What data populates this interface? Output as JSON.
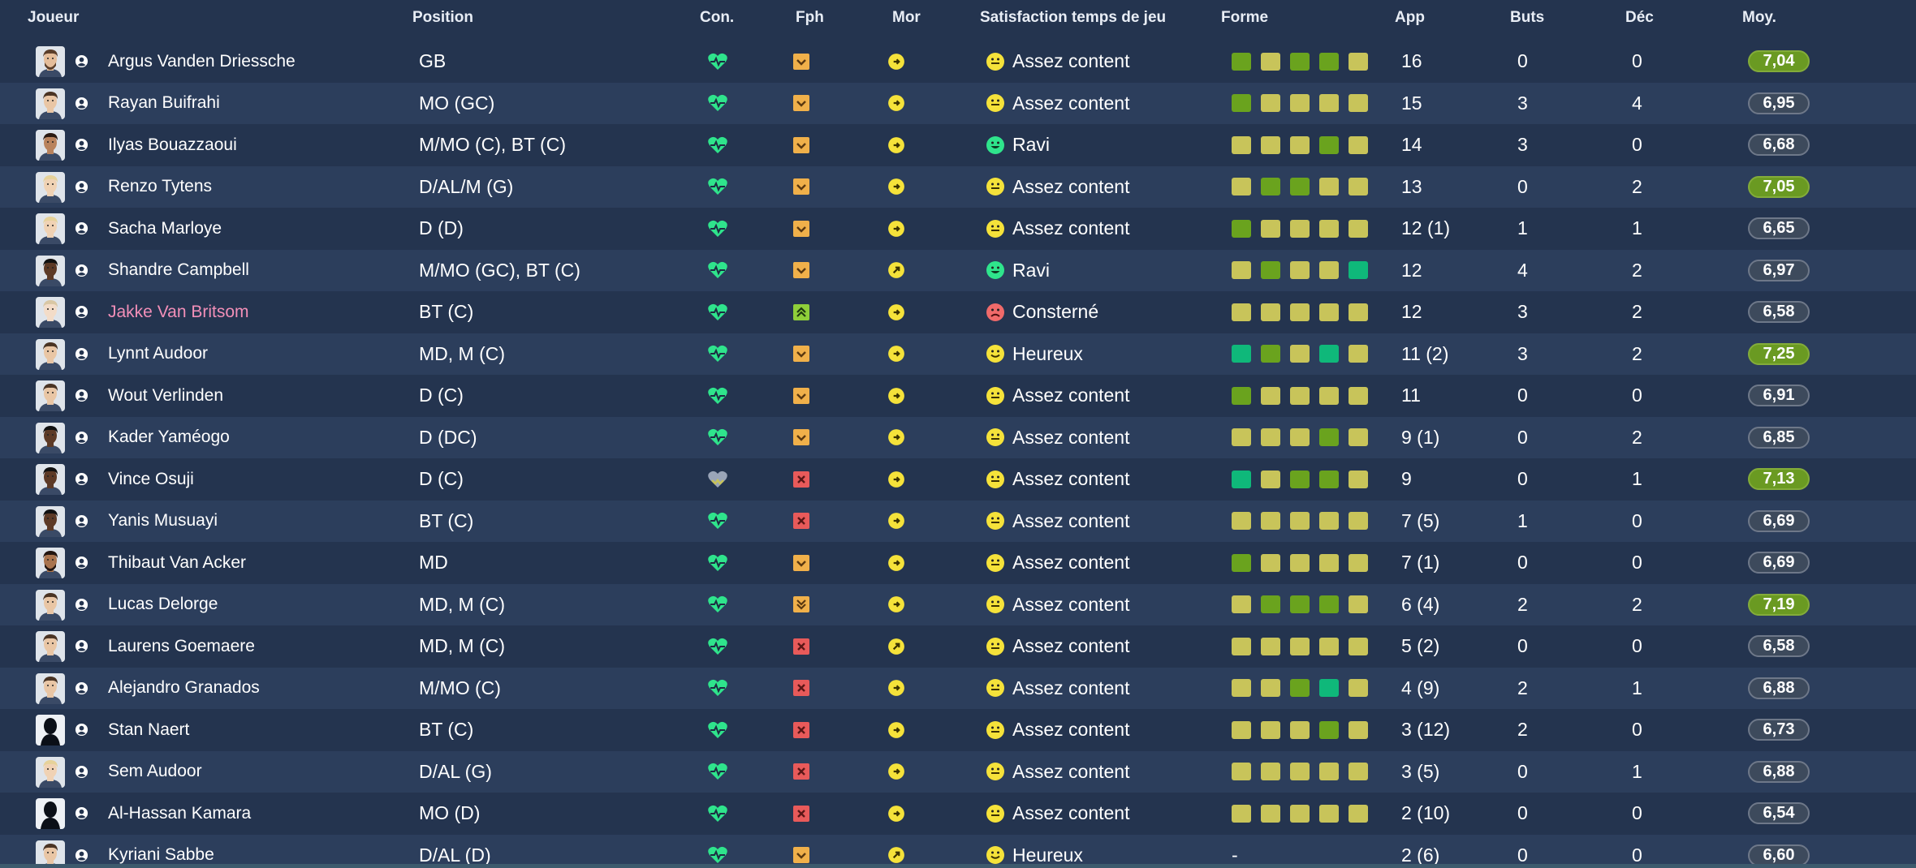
{
  "columns": {
    "joueur": "Joueur",
    "position": "Position",
    "con": "Con.",
    "fph": "Fph",
    "mor": "Mor",
    "satisfaction": "Satisfaction temps de jeu",
    "forme": "Forme",
    "app": "App",
    "buts": "Buts",
    "dec": "Déc",
    "moy": "Moy."
  },
  "colors": {
    "background": "#24344f",
    "row_alt": "#2c3e5c",
    "heart": "#2fe48c",
    "form_yellow": "#c8c45a",
    "form_green": "#6aa31e",
    "form_teal": "#0fb87a",
    "fph_orange": "#f0b04a",
    "fph_red": "#e85a5a",
    "fph_up_green": "#8fcf3a",
    "morale_yellow": "#f5e23a",
    "highlight_name": "#f28fb8",
    "badge_good": "#6a9a22"
  },
  "players": [
    {
      "name": "Argus Vanden Driessche",
      "position": "GB",
      "con": "heart",
      "fph": "down-small",
      "mor": "right",
      "face": "neutral",
      "satisfaction": "Assez content",
      "form": [
        "g",
        "y",
        "g",
        "g",
        "y"
      ],
      "app": "16",
      "buts": "0",
      "dec": "0",
      "moy": "7,04",
      "moy_style": "good",
      "avatar": "light-bearded",
      "highlight": false
    },
    {
      "name": "Rayan Buifrahi",
      "position": "MO (GC)",
      "con": "heart",
      "fph": "down-small",
      "mor": "right",
      "face": "neutral",
      "satisfaction": "Assez content",
      "form": [
        "g",
        "y",
        "y",
        "y",
        "y"
      ],
      "app": "15",
      "buts": "3",
      "dec": "4",
      "moy": "6,95",
      "moy_style": "normal",
      "avatar": "light",
      "highlight": false
    },
    {
      "name": "Ilyas Bouazzaoui",
      "position": "M/MO (C), BT (C)",
      "con": "heart",
      "fph": "down-small",
      "mor": "right",
      "face": "happy",
      "satisfaction": "Ravi",
      "form": [
        "y",
        "y",
        "y",
        "g",
        "y"
      ],
      "app": "14",
      "buts": "3",
      "dec": "0",
      "moy": "6,68",
      "moy_style": "normal",
      "avatar": "medium",
      "highlight": false
    },
    {
      "name": "Renzo Tytens",
      "position": "D/AL/M (G)",
      "con": "heart",
      "fph": "down-small",
      "mor": "right",
      "face": "neutral",
      "satisfaction": "Assez content",
      "form": [
        "y",
        "g",
        "g",
        "y",
        "y"
      ],
      "app": "13",
      "buts": "0",
      "dec": "2",
      "moy": "7,05",
      "moy_style": "good",
      "avatar": "blond",
      "highlight": false
    },
    {
      "name": "Sacha Marloye",
      "position": "D (D)",
      "con": "heart",
      "fph": "down-small",
      "mor": "right",
      "face": "neutral",
      "satisfaction": "Assez content",
      "form": [
        "g",
        "y",
        "y",
        "y",
        "y"
      ],
      "app": "12 (1)",
      "buts": "1",
      "dec": "1",
      "moy": "6,65",
      "moy_style": "normal",
      "avatar": "blond",
      "highlight": false
    },
    {
      "name": "Shandre Campbell",
      "position": "M/MO (GC), BT (C)",
      "con": "heart",
      "fph": "down-small",
      "mor": "up-right",
      "face": "happy",
      "satisfaction": "Ravi",
      "form": [
        "y",
        "g",
        "y",
        "y",
        "t"
      ],
      "app": "12",
      "buts": "4",
      "dec": "2",
      "moy": "6,97",
      "moy_style": "normal",
      "avatar": "dark",
      "highlight": false
    },
    {
      "name": "Jakke Van Britsom",
      "position": "BT (C)",
      "con": "heart",
      "fph": "up-double",
      "mor": "right",
      "face": "sad",
      "satisfaction": "Consterné",
      "form": [
        "y",
        "y",
        "y",
        "y",
        "y"
      ],
      "app": "12",
      "buts": "3",
      "dec": "2",
      "moy": "6,58",
      "moy_style": "normal",
      "avatar": "pale",
      "highlight": true
    },
    {
      "name": "Lynnt Audoor",
      "position": "MD, M (C)",
      "con": "heart",
      "fph": "down-small",
      "mor": "right",
      "face": "smile",
      "satisfaction": "Heureux",
      "form": [
        "t",
        "g",
        "y",
        "t",
        "y"
      ],
      "app": "11 (2)",
      "buts": "3",
      "dec": "2",
      "moy": "7,25",
      "moy_style": "good",
      "avatar": "light",
      "highlight": false
    },
    {
      "name": "Wout Verlinden",
      "position": "D (C)",
      "con": "heart",
      "fph": "down-small",
      "mor": "right",
      "face": "neutral",
      "satisfaction": "Assez content",
      "form": [
        "g",
        "y",
        "y",
        "y",
        "y"
      ],
      "app": "11",
      "buts": "0",
      "dec": "0",
      "moy": "6,91",
      "moy_style": "normal",
      "avatar": "light",
      "highlight": false
    },
    {
      "name": "Kader Yaméogo",
      "position": "D (DC)",
      "con": "heart",
      "fph": "down-small",
      "mor": "right",
      "face": "neutral",
      "satisfaction": "Assez content",
      "form": [
        "y",
        "y",
        "y",
        "g",
        "y"
      ],
      "app": "9 (1)",
      "buts": "0",
      "dec": "2",
      "moy": "6,85",
      "moy_style": "normal",
      "avatar": "dark",
      "highlight": false
    },
    {
      "name": "Vince Osuji",
      "position": "D (C)",
      "con": "heart-half",
      "fph": "cross",
      "mor": "right",
      "face": "neutral",
      "satisfaction": "Assez content",
      "form": [
        "t",
        "y",
        "g",
        "g",
        "y"
      ],
      "app": "9",
      "buts": "0",
      "dec": "1",
      "moy": "7,13",
      "moy_style": "good",
      "avatar": "dark",
      "highlight": false
    },
    {
      "name": "Yanis Musuayi",
      "position": "BT (C)",
      "con": "heart",
      "fph": "cross",
      "mor": "right",
      "face": "neutral",
      "satisfaction": "Assez content",
      "form": [
        "y",
        "y",
        "y",
        "y",
        "y"
      ],
      "app": "7 (5)",
      "buts": "1",
      "dec": "0",
      "moy": "6,69",
      "moy_style": "normal",
      "avatar": "dark",
      "highlight": false
    },
    {
      "name": "Thibaut Van Acker",
      "position": "MD",
      "con": "heart",
      "fph": "down-small",
      "mor": "right",
      "face": "neutral",
      "satisfaction": "Assez content",
      "form": [
        "g",
        "y",
        "y",
        "y",
        "y"
      ],
      "app": "7 (1)",
      "buts": "0",
      "dec": "0",
      "moy": "6,69",
      "moy_style": "normal",
      "avatar": "medium-bearded",
      "highlight": false
    },
    {
      "name": "Lucas Delorge",
      "position": "MD, M (C)",
      "con": "heart",
      "fph": "down-double",
      "mor": "right",
      "face": "neutral",
      "satisfaction": "Assez content",
      "form": [
        "y",
        "g",
        "g",
        "g",
        "y"
      ],
      "app": "6 (4)",
      "buts": "2",
      "dec": "2",
      "moy": "7,19",
      "moy_style": "good",
      "avatar": "light",
      "highlight": false
    },
    {
      "name": "Laurens Goemaere",
      "position": "MD, M (C)",
      "con": "heart",
      "fph": "cross",
      "mor": "up-right",
      "face": "neutral",
      "satisfaction": "Assez content",
      "form": [
        "y",
        "y",
        "y",
        "y",
        "y"
      ],
      "app": "5 (2)",
      "buts": "0",
      "dec": "0",
      "moy": "6,58",
      "moy_style": "normal",
      "avatar": "light",
      "highlight": false
    },
    {
      "name": "Alejandro Granados",
      "position": "M/MO (C)",
      "con": "heart",
      "fph": "cross",
      "mor": "right",
      "face": "neutral",
      "satisfaction": "Assez content",
      "form": [
        "y",
        "y",
        "g",
        "t",
        "y"
      ],
      "app": "4 (9)",
      "buts": "2",
      "dec": "1",
      "moy": "6,88",
      "moy_style": "normal",
      "avatar": "light",
      "highlight": false
    },
    {
      "name": "Stan Naert",
      "position": "BT (C)",
      "con": "heart",
      "fph": "cross",
      "mor": "right",
      "face": "neutral",
      "satisfaction": "Assez content",
      "form": [
        "y",
        "y",
        "y",
        "g",
        "y"
      ],
      "app": "3 (12)",
      "buts": "2",
      "dec": "0",
      "moy": "6,73",
      "moy_style": "normal",
      "avatar": "silhouette",
      "highlight": false
    },
    {
      "name": "Sem Audoor",
      "position": "D/AL (G)",
      "con": "heart",
      "fph": "cross",
      "mor": "right",
      "face": "neutral",
      "satisfaction": "Assez content",
      "form": [
        "y",
        "y",
        "y",
        "y",
        "y"
      ],
      "app": "3 (5)",
      "buts": "0",
      "dec": "1",
      "moy": "6,88",
      "moy_style": "normal",
      "avatar": "blond",
      "highlight": false
    },
    {
      "name": "Al-Hassan Kamara",
      "position": "MO (D)",
      "con": "heart",
      "fph": "cross",
      "mor": "right",
      "face": "neutral",
      "satisfaction": "Assez content",
      "form": [
        "y",
        "y",
        "y",
        "y",
        "y"
      ],
      "app": "2 (10)",
      "buts": "0",
      "dec": "0",
      "moy": "6,54",
      "moy_style": "normal",
      "avatar": "silhouette",
      "highlight": false
    },
    {
      "name": "Kyriani Sabbe",
      "position": "D/AL (D)",
      "con": "heart",
      "fph": "down-small",
      "mor": "up-right",
      "face": "smile",
      "satisfaction": "Heureux",
      "form": [],
      "form_text": "-",
      "app": "2 (6)",
      "buts": "0",
      "dec": "0",
      "moy": "6,60",
      "moy_style": "normal",
      "avatar": "light",
      "highlight": false
    }
  ]
}
